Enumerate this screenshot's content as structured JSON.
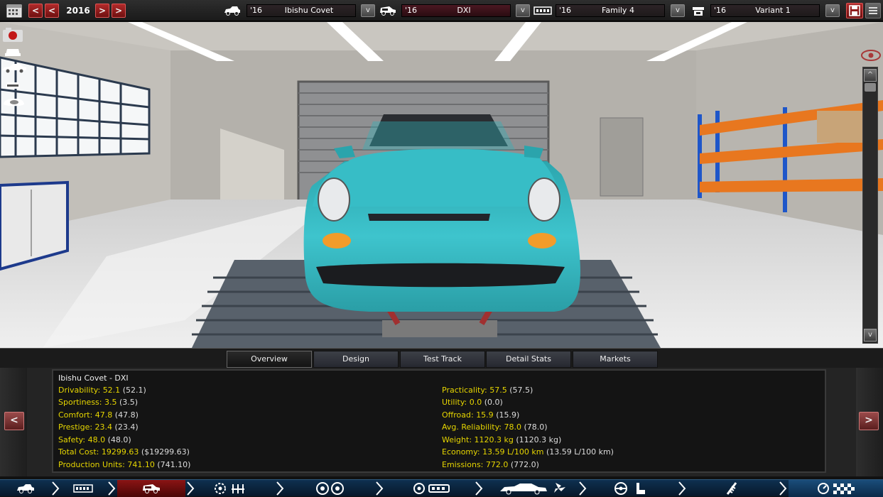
{
  "topbar": {
    "year": "2016",
    "selectors": [
      {
        "year": "'16",
        "name": "Ibishu Covet",
        "icon": "car-model-icon"
      },
      {
        "year": "'16",
        "name": "DXI",
        "icon": "trim-icon"
      },
      {
        "year": "'16",
        "name": "Family 4",
        "icon": "engine-family-icon"
      },
      {
        "year": "'16",
        "name": "Variant 1",
        "icon": "engine-variant-icon"
      }
    ],
    "prev_symbol": "<",
    "next_symbol": ">",
    "dropdown_symbol": "v"
  },
  "view": {
    "scroll_up": "^",
    "scroll_down": "v",
    "icons": [
      "camera-icon",
      "car-front-icon",
      "car-side-icon",
      "car-rear-icon",
      "car-top-icon",
      "eye-icon",
      "close-view-icon"
    ]
  },
  "tabs": [
    "Overview",
    "Design",
    "Test Track",
    "Detail Stats",
    "Markets"
  ],
  "active_tab": "Overview",
  "panel": {
    "title": "Ibishu Covet - DXI",
    "prev": "<",
    "next": ">",
    "left_stats": [
      {
        "label": "Drivability:",
        "value": "52.1",
        "paren": "(52.1)"
      },
      {
        "label": "Sportiness:",
        "value": "3.5",
        "paren": "(3.5)"
      },
      {
        "label": "Comfort:",
        "value": "47.8",
        "paren": "(47.8)"
      },
      {
        "label": "Prestige:",
        "value": "23.4",
        "paren": "(23.4)"
      },
      {
        "label": "Safety:",
        "value": "48.0",
        "paren": "(48.0)"
      },
      {
        "label": "Total Cost:",
        "value": "19299.63",
        "paren": "($19299.63)"
      },
      {
        "label": "Production Units:",
        "value": "741.10",
        "paren": "(741.10)"
      }
    ],
    "right_stats": [
      {
        "label": "Practicality:",
        "value": "57.5",
        "paren": "(57.5)"
      },
      {
        "label": "Utility:",
        "value": "0.0",
        "paren": "(0.0)"
      },
      {
        "label": "Offroad:",
        "value": "15.9",
        "paren": "(15.9)"
      },
      {
        "label": "Avg. Reliability:",
        "value": "78.0",
        "paren": "(78.0)"
      },
      {
        "label": "Weight:",
        "value": "1120.3 kg",
        "paren": "(1120.3 kg)"
      },
      {
        "label": "Economy:",
        "value": "13.59 L/100 km",
        "paren": "(13.59 L/100 km)"
      },
      {
        "label": "Emissions:",
        "value": "772.0",
        "paren": "(772.0)"
      }
    ]
  },
  "bottom_nav": [
    {
      "icon": "car-model-nav-icon"
    },
    {
      "icon": "chassis-nav-icon"
    },
    {
      "icon": "trim-nav-icon",
      "active": true
    },
    {
      "icon": "engine-nav-icon"
    },
    {
      "icon": "wheels-nav-icon"
    },
    {
      "icon": "brakes-nav-icon"
    },
    {
      "icon": "body-aero-nav-icon"
    },
    {
      "icon": "interior-nav-icon"
    },
    {
      "icon": "suspension-nav-icon"
    },
    {
      "icon": "finish-nav-icon"
    }
  ],
  "colors": {
    "car_paint": "#35b9c2",
    "stat_yellow": "#e6d500",
    "accent_red": "#8a1414",
    "nav_blue": "#0e3050"
  }
}
